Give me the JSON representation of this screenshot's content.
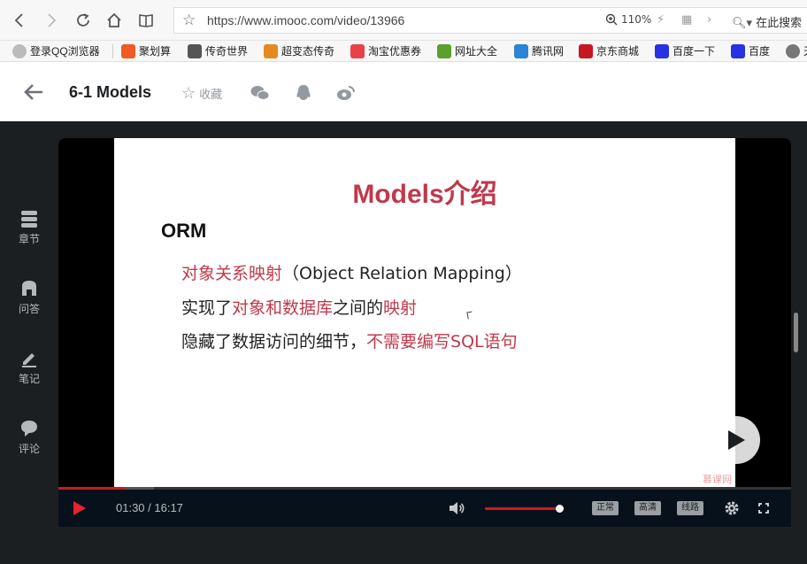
{
  "browser": {
    "url": "https://www.imooc.com/video/13966",
    "zoom": "110%",
    "search_placeholder": "在此搜索"
  },
  "bookmarks": [
    {
      "label": "登录QQ浏览器",
      "icon": "user-avatar-icon",
      "color": "#bbbbbb"
    },
    {
      "label": "聚划算",
      "icon": "juhuasuan-icon",
      "color": "#f15a22"
    },
    {
      "label": "传奇世界",
      "icon": "game-icon",
      "color": "#555555"
    },
    {
      "label": "超变态传奇",
      "icon": "game-icon",
      "color": "#e58a1f"
    },
    {
      "label": "淘宝优惠券",
      "icon": "coupon-icon",
      "color": "#e8414a"
    },
    {
      "label": "网址大全",
      "icon": "hao123-icon",
      "color": "#5aa02c"
    },
    {
      "label": "腾讯网",
      "icon": "tencent-icon",
      "color": "#2b84d6"
    },
    {
      "label": "京东商城",
      "icon": "jd-icon",
      "color": "#c81623"
    },
    {
      "label": "百度一下",
      "icon": "baidu-icon",
      "color": "#2932e1"
    },
    {
      "label": "百度",
      "icon": "baidu-icon",
      "color": "#2932e1"
    },
    {
      "label": "天",
      "icon": "globe-icon",
      "color": "#777777"
    }
  ],
  "header": {
    "title": "6-1 Models",
    "favorite_label": "收藏"
  },
  "sidebar": [
    {
      "label": "章节",
      "icon": "chapters-icon"
    },
    {
      "label": "问答",
      "icon": "qa-icon"
    },
    {
      "label": "笔记",
      "icon": "notes-icon"
    },
    {
      "label": "评论",
      "icon": "comment-icon"
    }
  ],
  "slide": {
    "title": "Models介绍",
    "heading": "ORM",
    "line1_red": "对象关系映射",
    "line1_black": "（Object Relation Mapping）",
    "line2_a": "实现了",
    "line2_b": "对象和数据库",
    "line2_c": "之间的",
    "line2_d": "映射",
    "line3_a": "隐藏了数据访问的细节，",
    "line3_b": "不需要编写SQL语句",
    "watermark": "慕课网"
  },
  "player": {
    "time": "01:30 / 16:17",
    "progress": 0.092,
    "buffered": 0.13,
    "volume": 0.95,
    "speed_label": "正常",
    "quality_label": "高清",
    "line_label": "线路",
    "accent": "#d0171f"
  }
}
